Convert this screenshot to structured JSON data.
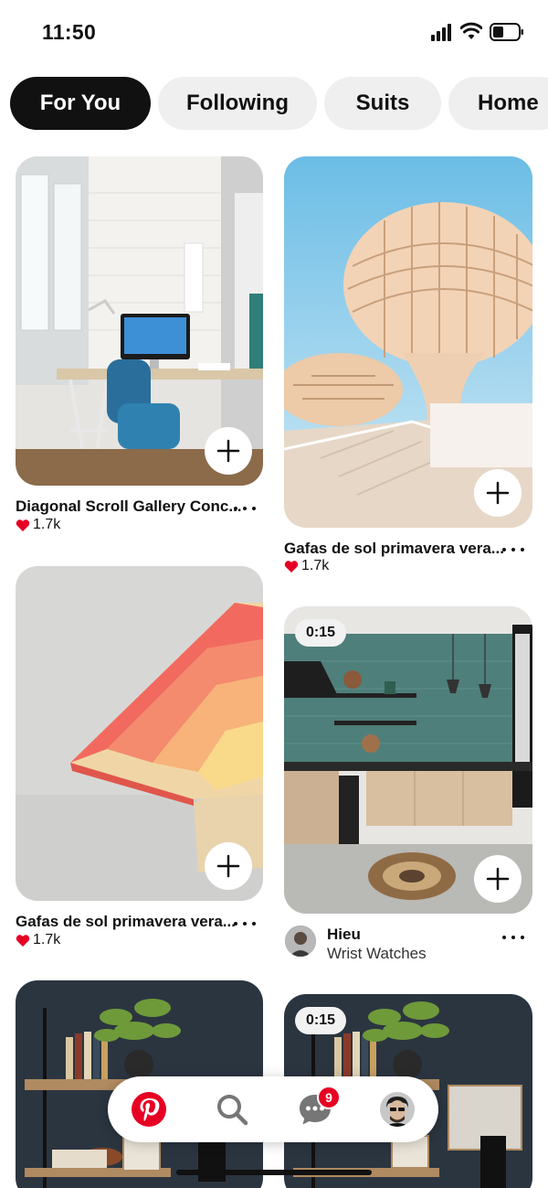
{
  "status_bar": {
    "time": "11:50"
  },
  "tabs": [
    {
      "label": "For You",
      "active": true
    },
    {
      "label": "Following",
      "active": false
    },
    {
      "label": "Suits",
      "active": false
    },
    {
      "label": "Home",
      "active": false
    }
  ],
  "pins": [
    {
      "title": "Diagonal Scroll Gallery Conc...",
      "likes": "1.7k"
    },
    {
      "title": "Gafas de sol primavera vera...",
      "likes": "1.7k"
    },
    {
      "title": "Gafas de sol primavera vera...",
      "likes": "1.7k"
    },
    {
      "duration": "0:15",
      "author": "Hieu",
      "board": "Wrist Watches"
    },
    {
      "title": ""
    },
    {
      "duration": "0:15"
    }
  ],
  "bottom_nav": {
    "items": [
      "pinterest-home-icon",
      "search-icon",
      "messages-icon",
      "profile-avatar"
    ],
    "messages_badge": "9"
  },
  "colors": {
    "brand_red": "#e60023",
    "active_tab": "#111111",
    "tab_bg": "#efefef"
  }
}
